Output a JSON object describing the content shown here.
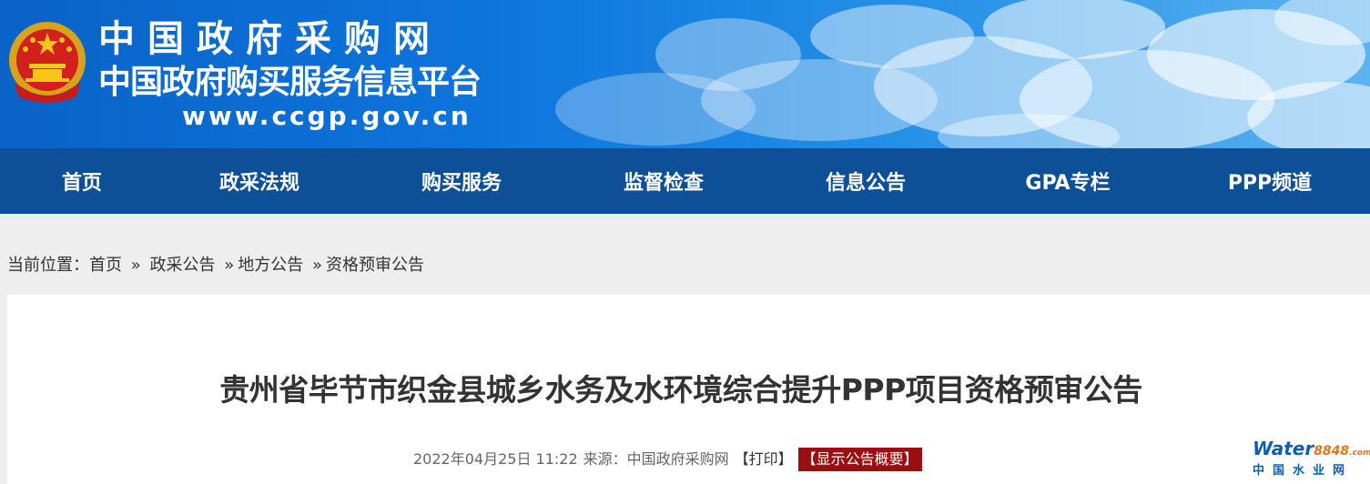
{
  "header": {
    "title": "中国政府采购网",
    "subtitle": "中国政府购买服务信息平台",
    "url": "www.ccgp.gov.cn",
    "emblem_icon": "national-emblem-icon",
    "colors": {
      "banner": "#0d74dc",
      "nav": "#0d5098"
    }
  },
  "nav": {
    "items": [
      {
        "label": "首页"
      },
      {
        "label": "政采法规"
      },
      {
        "label": "购买服务"
      },
      {
        "label": "监督检查"
      },
      {
        "label": "信息公告"
      },
      {
        "label": "GPA专栏"
      },
      {
        "label": "PPP频道"
      }
    ]
  },
  "breadcrumb": {
    "prefix": "当前位置：",
    "items": [
      {
        "label": "首页"
      },
      {
        "label": "政采公告"
      },
      {
        "label": "地方公告"
      },
      {
        "label": "资格预审公告"
      }
    ],
    "separator": "»"
  },
  "article": {
    "title": "贵州省毕节市织金县城乡水务及水环境综合提升PPP项目资格预审公告",
    "datetime": "2022年04月25日 11:22",
    "source": "来源：中国政府采购网",
    "print_label": "【打印】",
    "summary_label": "【显示公告概要】",
    "colors": {
      "summary_bg": "#9a0f12"
    }
  },
  "watermark": {
    "brand": "Water",
    "brand_suffix": "8848",
    "brand_domain": ".com",
    "tagline": "中国水业网"
  }
}
